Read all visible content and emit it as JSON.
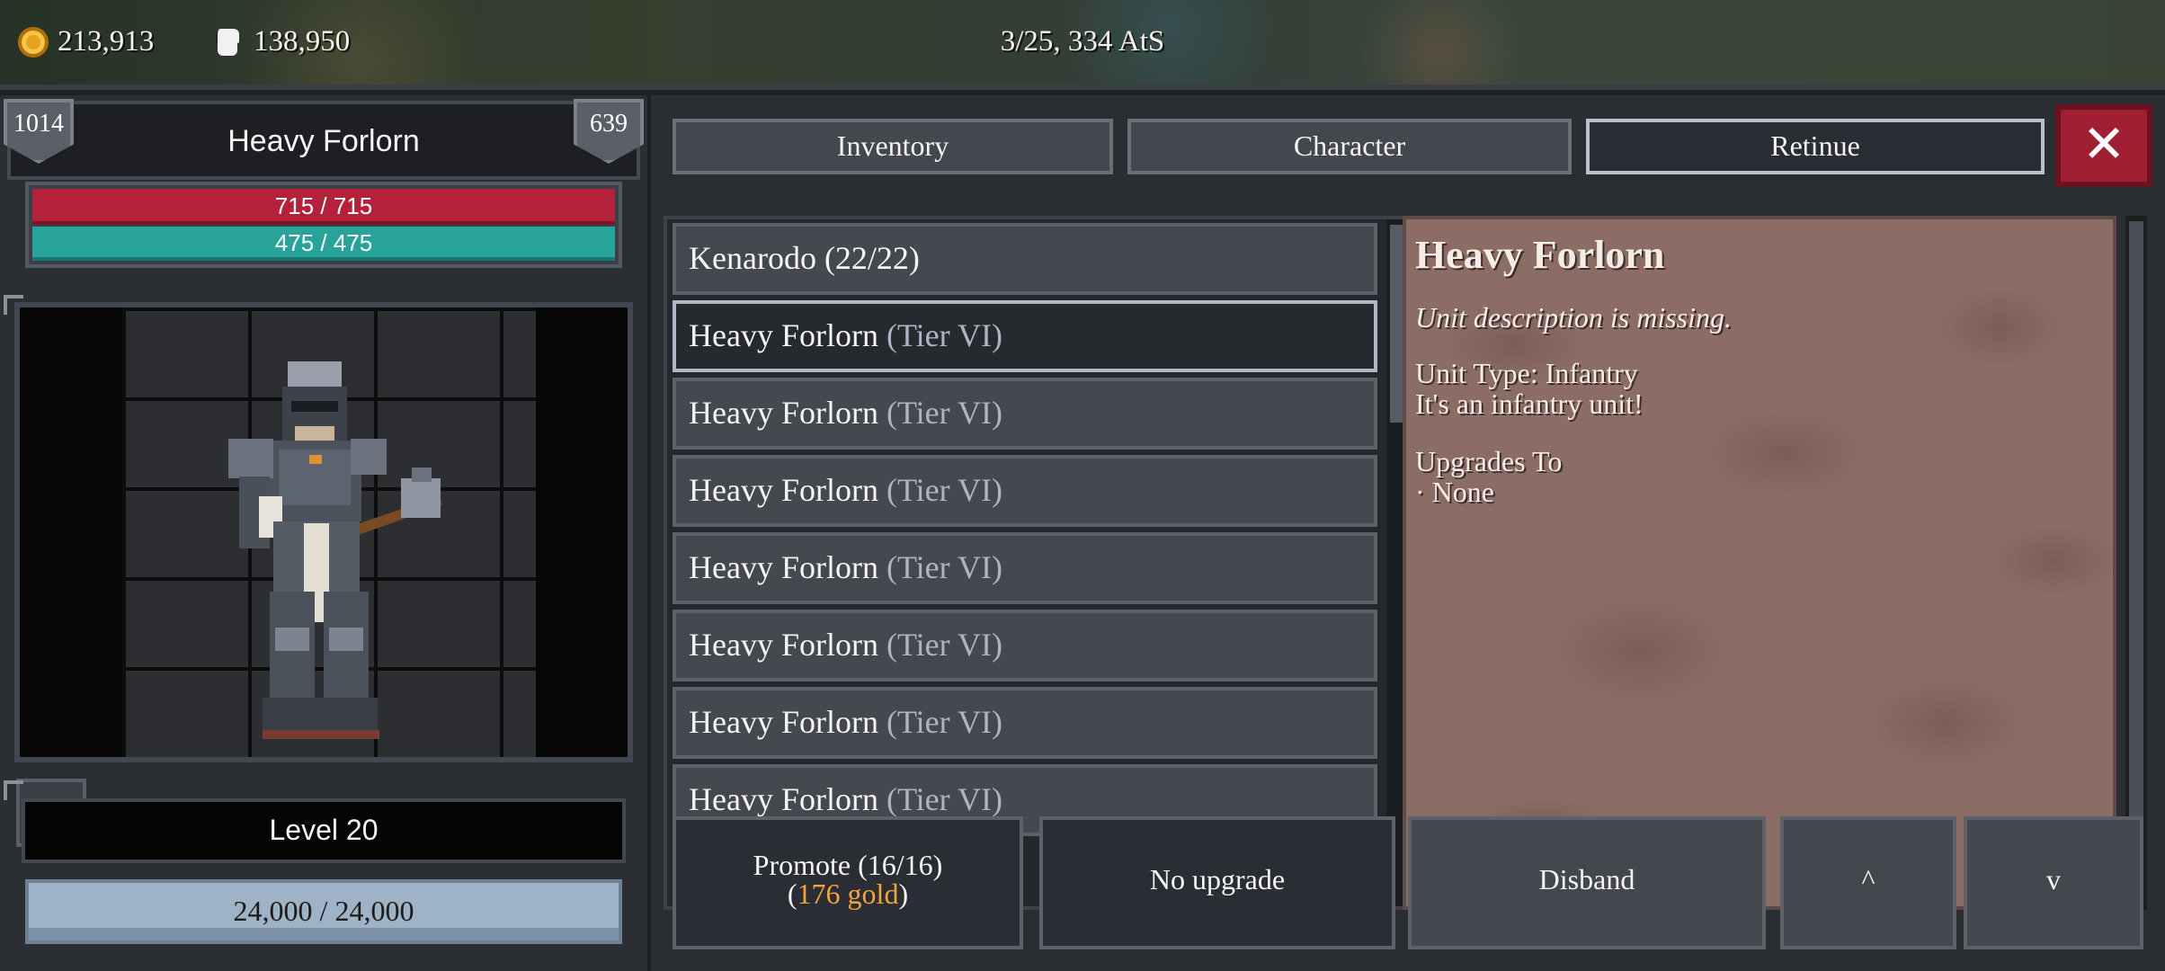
{
  "topbar": {
    "gold": "213,913",
    "strength": "138,950",
    "date": "3/25, 334 AtS"
  },
  "unit_card": {
    "badge_left": "1014",
    "badge_right": "639",
    "name": "Heavy Forlorn",
    "hp": "715 / 715",
    "mana": "475 / 475",
    "level": "Level 20",
    "xp": "24,000  /  24,000",
    "up_arrow": "▲"
  },
  "tabs": [
    {
      "label": "Inventory"
    },
    {
      "label": "Character"
    },
    {
      "label": "Retinue"
    }
  ],
  "close_label": "✕",
  "list": [
    {
      "name": "Kenarodo (22/22)",
      "tier": ""
    },
    {
      "name": "Heavy Forlorn",
      "tier": "(Tier VI)"
    },
    {
      "name": "Heavy Forlorn",
      "tier": "(Tier VI)"
    },
    {
      "name": "Heavy Forlorn",
      "tier": "(Tier VI)"
    },
    {
      "name": "Heavy Forlorn",
      "tier": "(Tier VI)"
    },
    {
      "name": "Heavy Forlorn",
      "tier": "(Tier VI)"
    },
    {
      "name": "Heavy Forlorn",
      "tier": "(Tier VI)"
    },
    {
      "name": "Heavy Forlorn",
      "tier": "(Tier VI)"
    }
  ],
  "detail": {
    "title": "Heavy Forlorn",
    "description": "Unit description is missing.",
    "unit_type": "Unit Type: Infantry",
    "unit_type_desc": "It's an infantry unit!",
    "upgrades_heading": "Upgrades To",
    "upgrades_value": "· None"
  },
  "actions": {
    "promote_line1": "Promote (16/16)",
    "promote_open": "(",
    "promote_gold": "176 gold",
    "promote_close": ")",
    "no_upgrade": "No upgrade",
    "disband": "Disband",
    "move_up": "^",
    "move_down": "v"
  },
  "colors": {
    "hp": "#b3223a",
    "mana": "#27a39a",
    "close": "#a11f33",
    "gold": "#f1a53a"
  }
}
